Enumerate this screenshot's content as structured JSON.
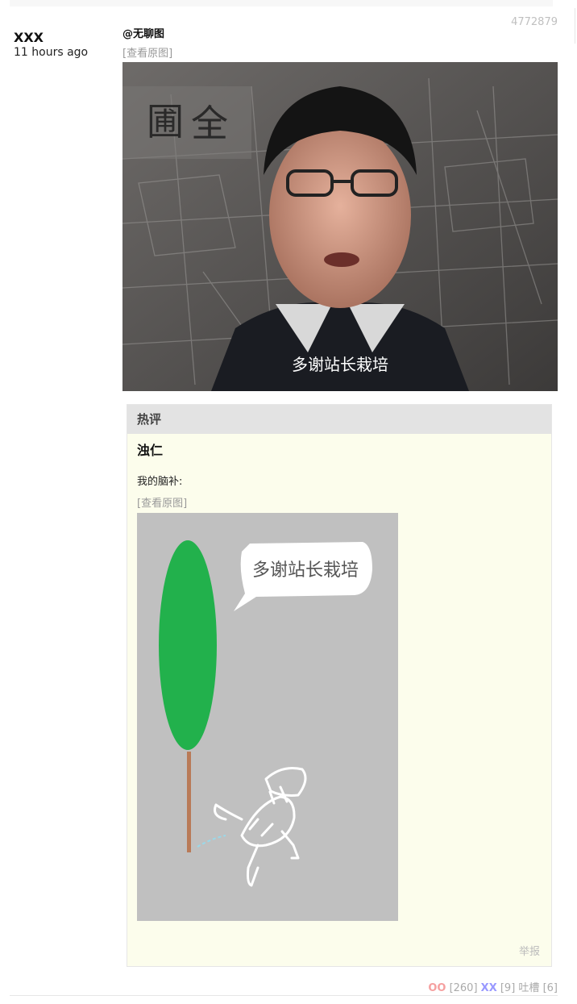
{
  "post": {
    "author": "XXX",
    "time": "11 hours ago",
    "id": "4772879",
    "mention": "@无聊图",
    "view_original": "[查看原图]",
    "image_caption": "多谢站长栽培"
  },
  "hot_comment": {
    "header": "热评",
    "author": "浊仁",
    "text": "我的脑补:",
    "view_original": "[查看原图]",
    "drawing_caption": "多谢站长栽培",
    "report": "举报"
  },
  "footer": {
    "oo_label": "OO",
    "oo_count": "[260]",
    "xx_label": "XX",
    "xx_count": "[9]",
    "tucao_label": "吐槽",
    "tucao_count": "[6]"
  },
  "colors": {
    "oo": "#f5a0a0",
    "xx": "#9999ff",
    "hot_bg": "#fcfdec",
    "tree": "#22b14c",
    "trunk": "#b97a57"
  }
}
